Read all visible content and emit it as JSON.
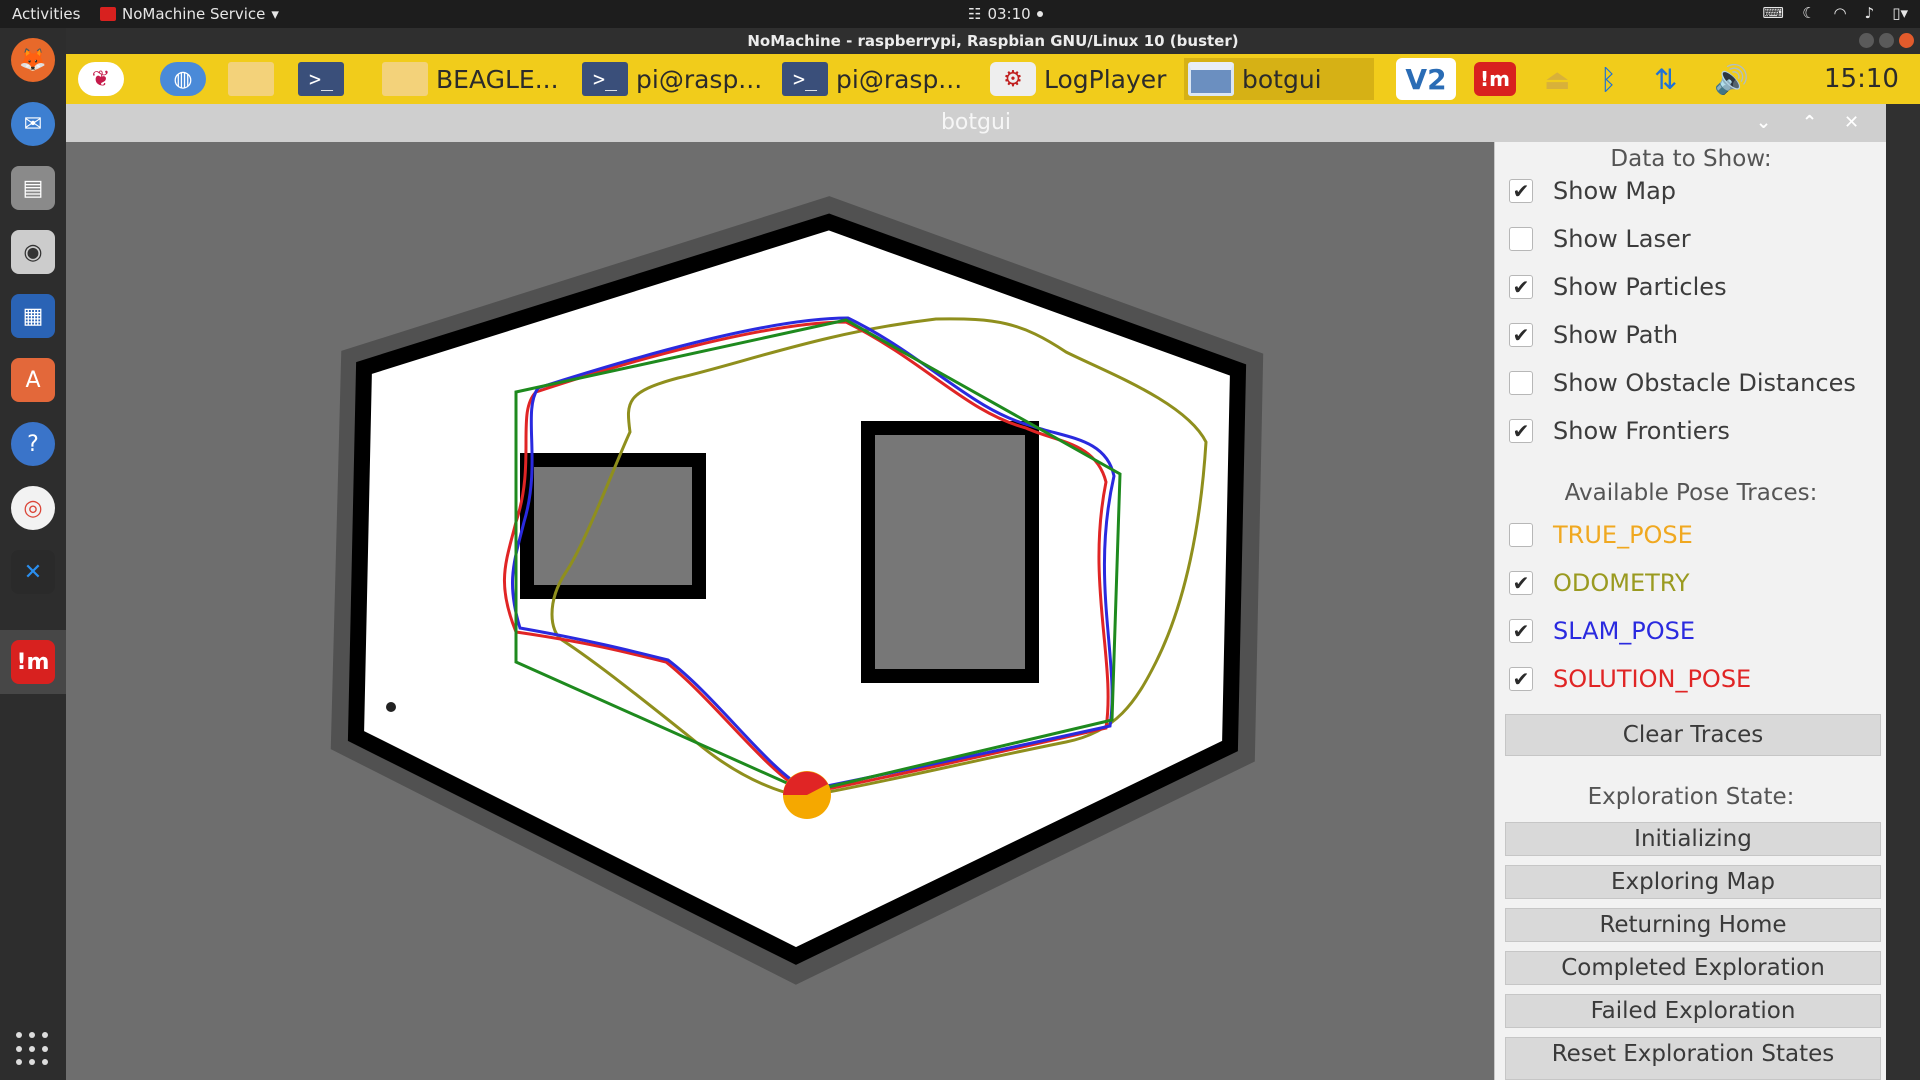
{
  "topbar": {
    "activities": "Activities",
    "app_menu": "NoMachine Service",
    "clock": "03:10"
  },
  "nomachine": {
    "title": "NoMachine - raspberrypi, Raspbian GNU/Linux 10 (buster)"
  },
  "rpi_panel": {
    "tasks": [
      {
        "label": "BEAGLE..."
      },
      {
        "label": "pi@rasp..."
      },
      {
        "label": "pi@rasp..."
      },
      {
        "label": "LogPlayer"
      },
      {
        "label": "botgui"
      }
    ],
    "vnc_label": "V2",
    "nm_label": "!m",
    "time": "15:10"
  },
  "botgui": {
    "title": "botgui",
    "data_section_title": "Data to Show:",
    "options": [
      {
        "label": "Show Map",
        "checked": true
      },
      {
        "label": "Show Laser",
        "checked": false
      },
      {
        "label": "Show Particles",
        "checked": true
      },
      {
        "label": "Show Path",
        "checked": true
      },
      {
        "label": "Show Obstacle Distances",
        "checked": false
      },
      {
        "label": "Show Frontiers",
        "checked": true
      }
    ],
    "traces_title": "Available Pose Traces:",
    "traces": [
      {
        "label": "TRUE_POSE",
        "checked": false,
        "color": "#f0a820"
      },
      {
        "label": "ODOMETRY",
        "checked": true,
        "color": "#9a9a20"
      },
      {
        "label": "SLAM_POSE",
        "checked": true,
        "color": "#2a2adf"
      },
      {
        "label": "SOLUTION_POSE",
        "checked": true,
        "color": "#e02525"
      }
    ],
    "clear_traces": "Clear Traces",
    "exploration_title": "Exploration State:",
    "states": [
      "Initializing",
      "Exploring Map",
      "Returning Home",
      "Completed Exploration",
      "Failed Exploration",
      "Reset Exploration States"
    ]
  },
  "check_glyph": "✔",
  "colors": {
    "rpi_panel": "#f1cc1b",
    "map_free": "#ffffff",
    "map_unknown": "#6e6e6e",
    "map_wall": "#000000",
    "path_green": "#1e8a1e",
    "robot": "#f5a800"
  }
}
